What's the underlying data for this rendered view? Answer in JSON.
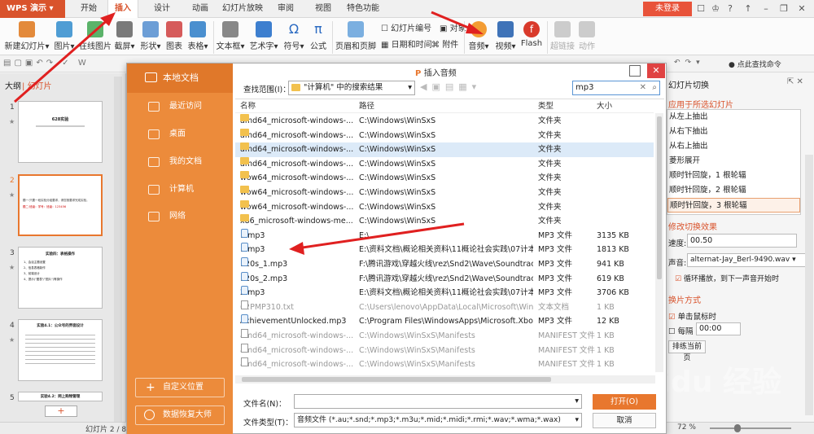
{
  "app": {
    "name": "WPS 演示",
    "login": "未登录"
  },
  "tabs": [
    "开始",
    "插入",
    "设计",
    "动画",
    "幻灯片放映",
    "审阅",
    "视图",
    "特色功能"
  ],
  "ribbon": {
    "new_slide": "新建幻灯片",
    "picture": "图片",
    "online_pic": "在线图片",
    "screenshot": "截屏",
    "shape": "形状",
    "chart": "图表",
    "table": "表格",
    "textbox": "文本框",
    "wordart": "艺术字",
    "symbol": "符号",
    "formula": "公式",
    "header_footer": "页眉和页脚",
    "slide_number": "幻灯片编号",
    "datetime": "日期和时间",
    "object": "对象",
    "attachment": "附件",
    "audio": "音频",
    "video": "视频",
    "flash": "Flash",
    "hyperlink": "超链接",
    "action": "动作"
  },
  "search_cmd": "点此查找命令",
  "left": {
    "tab_outline": "大纲",
    "tab_slides": "幻灯片",
    "slide_nums": [
      "1",
      "2",
      "3",
      "4",
      "5"
    ],
    "slide1_title": "628实验",
    "slide2_line1": "题一:只要一段实验分组要求，请您按要求完成实验，",
    "slide2_line2": "题二:班级：学号：班级：123456",
    "slide3_title": "实验四：表格操作",
    "slide3_items": [
      "1、会话主题设置",
      "2、信息表格制作",
      "3、前端设计",
      "4、提示(\"图表\"/\"图片\")等操作"
    ],
    "slide4_title": "实验4.1：公众号的界面设计",
    "slide5_title": "实验4.2：网上购物管理",
    "add": "+"
  },
  "status": {
    "slide_info": "幻灯片 2 / 8",
    "zoom": "72 %"
  },
  "right": {
    "header": "幻灯片切换",
    "apply": "应用于所选幻灯片",
    "effects": [
      "从左上抽出",
      "从右下抽出",
      "从右上抽出",
      "菱形展开",
      "顺时针回旋，1 根轮辐",
      "顺时针回旋，2 根轮辐",
      "顺时针回旋，3 根轮辐"
    ],
    "modify": "修改切换效果",
    "speed_label": "速度:",
    "speed": "00.50",
    "sound_label": "声音:",
    "sound": "alternat-Jay_Berl-9490.wav",
    "loop": "循环播放，到下一声音开始时",
    "mode": "换片方式",
    "click": "单击鼠标时",
    "every": "每隔",
    "every_val": "00:00",
    "rehearse": "排练当前页"
  },
  "dialog": {
    "title": "插入音频",
    "local": "本地文档",
    "nav": [
      "最近访问",
      "桌面",
      "我的文档",
      "计算机",
      "网络"
    ],
    "custom": "自定义位置",
    "recover": "数据恢复大师",
    "lookin_label": "查找范围(I)：",
    "lookin": "\"计算机\" 中的搜索结果",
    "search": "mp3",
    "cols": {
      "name": "名称",
      "path": "路径",
      "type": "类型",
      "size": "大小"
    },
    "rows": [
      {
        "name": "amd64_microsoft-windows-...",
        "path": "C:\\Windows\\WinSxS",
        "type": "文件夹",
        "size": "",
        "icon": "folder"
      },
      {
        "name": "amd64_microsoft-windows-...",
        "path": "C:\\Windows\\WinSxS",
        "type": "文件夹",
        "size": "",
        "icon": "folder"
      },
      {
        "name": "amd64_microsoft-windows-...",
        "path": "C:\\Windows\\WinSxS",
        "type": "文件夹",
        "size": "",
        "icon": "folder"
      },
      {
        "name": "amd64_microsoft-windows-...",
        "path": "C:\\Windows\\WinSxS",
        "type": "文件夹",
        "size": "",
        "icon": "folder"
      },
      {
        "name": "wow64_microsoft-windows-...",
        "path": "C:\\Windows\\WinSxS",
        "type": "文件夹",
        "size": "",
        "icon": "folder"
      },
      {
        "name": "wow64_microsoft-windows-...",
        "path": "C:\\Windows\\WinSxS",
        "type": "文件夹",
        "size": "",
        "icon": "folder"
      },
      {
        "name": "wow64_microsoft-windows-...",
        "path": "C:\\Windows\\WinSxS",
        "type": "文件夹",
        "size": "",
        "icon": "folder"
      },
      {
        "name": "x86_microsoft-windows-me...",
        "path": "C:\\Windows\\WinSxS",
        "type": "文件夹",
        "size": "",
        "icon": "folder"
      },
      {
        "name": "1.mp3",
        "path": "E:\\",
        "type": "MP3 文件",
        "size": "3135 KB",
        "icon": "mp3"
      },
      {
        "name": "1.mp3",
        "path": "E:\\资料文档\\概论相关资料\\11概论社会实践\\07计本1...",
        "type": "MP3 文件",
        "size": "1813 KB",
        "icon": "mp3"
      },
      {
        "name": "120s_1.mp3",
        "path": "F:\\腾讯游戏\\穿越火线\\rez\\Snd2\\Wave\\Soundtrack",
        "type": "MP3 文件",
        "size": "941 KB",
        "icon": "mp3"
      },
      {
        "name": "120s_2.mp3",
        "path": "F:\\腾讯游戏\\穿越火线\\rez\\Snd2\\Wave\\Soundtrack",
        "type": "MP3 文件",
        "size": "619 KB",
        "icon": "mp3"
      },
      {
        "name": "2.mp3",
        "path": "E:\\资料文档\\概论相关资料\\11概论社会实践\\07计本1...",
        "type": "MP3 文件",
        "size": "3706 KB",
        "icon": "mp3"
      },
      {
        "name": "62PMP310.txt",
        "path": "C:\\Users\\lenovo\\AppData\\Local\\Microsoft\\Wind...",
        "type": "文本文档",
        "size": "1 KB",
        "icon": "txt"
      },
      {
        "name": "AchievementUnlocked.mp3",
        "path": "C:\\Program Files\\WindowsApps\\Microsoft.Xbox...",
        "type": "MP3 文件",
        "size": "12 KB",
        "icon": "mp3"
      },
      {
        "name": "amd64_microsoft-windows-...",
        "path": "C:\\Windows\\WinSxS\\Manifests",
        "type": "MANIFEST 文件",
        "size": "1 KB",
        "icon": "txt"
      },
      {
        "name": "amd64_microsoft-windows-...",
        "path": "C:\\Windows\\WinSxS\\Manifests",
        "type": "MANIFEST 文件",
        "size": "1 KB",
        "icon": "txt"
      },
      {
        "name": "amd64_microsoft-windows-...",
        "path": "C:\\Windows\\WinSxS\\Manifests",
        "type": "MANIFEST 文件",
        "size": "1 KB",
        "icon": "txt"
      }
    ],
    "filename_label": "文件名(N)：",
    "filename": "",
    "filetype_label": "文件类型(T)：",
    "filetype": "音频文件 (*.au;*.snd;*.mp3;*.m3u;*.mid;*.midi;*.rmi;*.wav;*.wma;*.wax)",
    "open": "打开(O)",
    "cancel": "取消"
  },
  "watermark": "Baidu 经验"
}
